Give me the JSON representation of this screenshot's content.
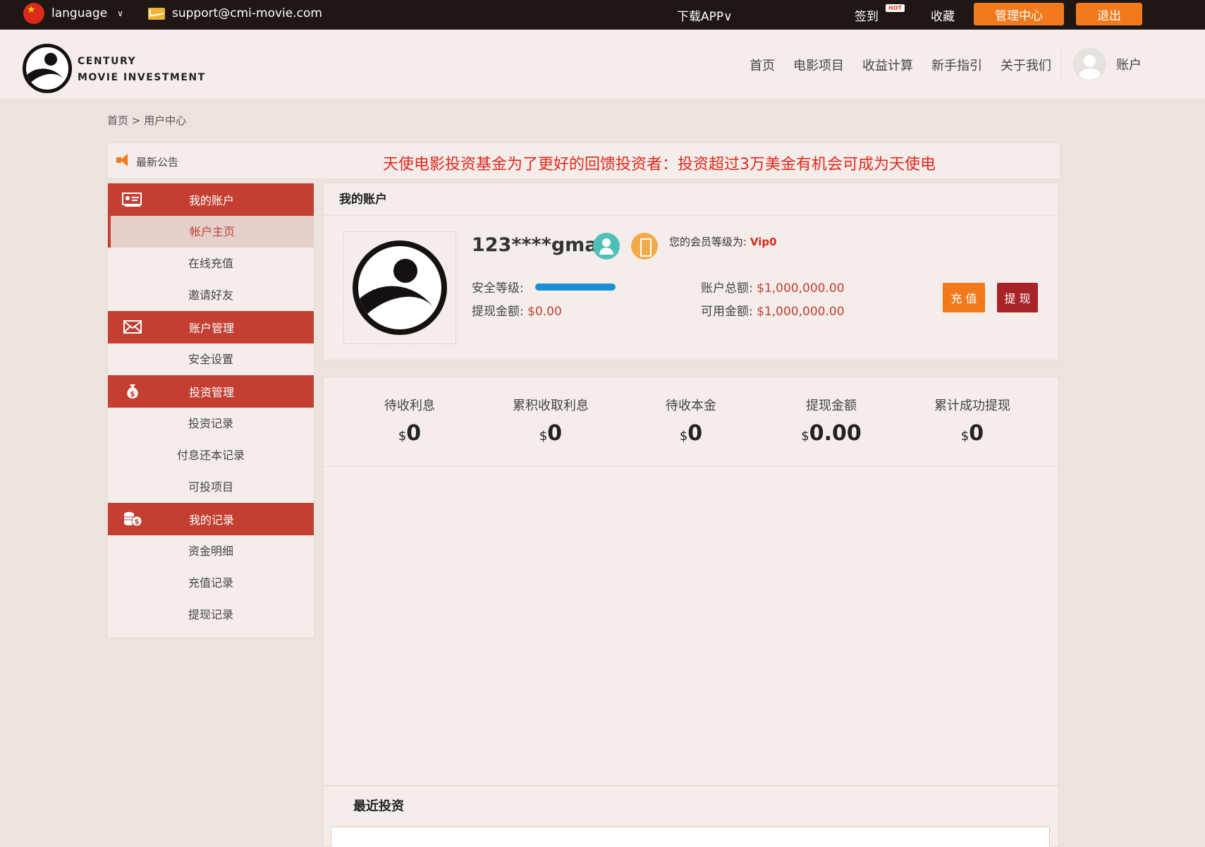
{
  "topbar": {
    "language_label": "language",
    "language_caret": "∨",
    "email": "support@cmi-movie.com",
    "download_app": "下载APP∨",
    "sign_in": "签到",
    "hot_badge": "HOT",
    "favorite": "收藏",
    "admin_center": "管理中心",
    "logout": "退出"
  },
  "header": {
    "brand_line1": "CENTURY",
    "brand_line2": "MOVIE INVESTMENT",
    "nav": [
      "首页",
      "电影项目",
      "收益计算",
      "新手指引",
      "关于我们"
    ],
    "account_label": "账户"
  },
  "breadcrumb": "首页 > 用户中心",
  "notice": {
    "label": "最新公告",
    "text": "天使电影投资基金为了更好的回馈投资者：投资超过3万美金有机会可成为天使电"
  },
  "sidebar": {
    "sections": [
      {
        "title": "我的账户",
        "icon": "id-card-icon",
        "items": [
          "帐户主页",
          "在线充值",
          "邀请好友"
        ]
      },
      {
        "title": "账户管理",
        "icon": "envelope-icon",
        "items": [
          "安全设置"
        ]
      },
      {
        "title": "投资管理",
        "icon": "money-bag-icon",
        "items": [
          "投资记录",
          "付息还本记录",
          "可投项目"
        ]
      },
      {
        "title": "我的记录",
        "icon": "coins-icon",
        "items": [
          "资金明细",
          "充值记录",
          "提现记录"
        ]
      }
    ],
    "active_item": "帐户主页"
  },
  "account": {
    "panel_title": "我的账户",
    "username": "123****gmai",
    "vip_label": "您的会员等级为:",
    "vip_level": "Vip0",
    "security_label": "安全等级:",
    "security_level_fraction": 1.0,
    "withdraw_amount_label": "提现金额:",
    "withdraw_amount": "$0.00",
    "total_label": "账户总额:",
    "total_value": "$1,000,000.00",
    "available_label": "可用金额:",
    "available_value": "$1,000,000.00",
    "recharge_button": "充 值",
    "withdraw_button": "提 现"
  },
  "stats": [
    {
      "label": "待收利息",
      "currency": "$",
      "value": "0"
    },
    {
      "label": "累积收取利息",
      "currency": "$",
      "value": "0"
    },
    {
      "label": "待收本金",
      "currency": "$",
      "value": "0"
    },
    {
      "label": "提现金额",
      "currency": "$",
      "value": "0.00"
    },
    {
      "label": "累计成功提现",
      "currency": "$",
      "value": "0"
    }
  ],
  "recent": {
    "title": "最近投资"
  },
  "colors": {
    "accent_red": "#c33f32",
    "orange": "#f07a1c",
    "dark_red": "#a82328",
    "notice_red": "#e0281e",
    "security_blue": "#1a8fd6"
  }
}
